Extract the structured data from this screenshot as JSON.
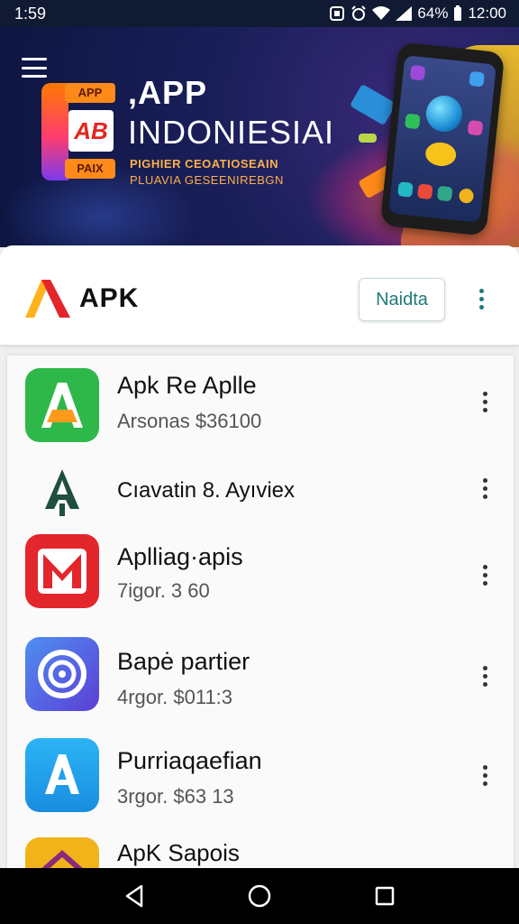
{
  "status_bar": {
    "time_left": "1:59",
    "battery": "64%",
    "time_right": "12:00"
  },
  "hero": {
    "badge_top": "APP",
    "badge_mid": "AB",
    "badge_bottom": "PAIX",
    "title_line1": ",APP",
    "title_line2": "INDONIESIAI",
    "subtitle_line1": "PIGHIER CEOATIOSEAIN",
    "subtitle_line2": "PLUAVIA GESEENIREBGN"
  },
  "header": {
    "brand": "APK",
    "action_button": "Naidta"
  },
  "apps": [
    {
      "title": "Apk Re Aplle",
      "subtitle": "Arsonas $36100",
      "icon": "android-a-icon",
      "color": "#2eb84a"
    },
    {
      "title": "Cıavatin 8. Ayıviex",
      "subtitle": "",
      "icon": "tree-a-icon",
      "color": "#1f4f3f"
    },
    {
      "title": "Aplliag·apis",
      "subtitle": "7igor. 3 60",
      "icon": "m-brand-icon",
      "color": "#e3262c"
    },
    {
      "title": "Bapė partier",
      "subtitle": "4rgor. $011:3",
      "icon": "spiral-icon",
      "color": "#3b6fe8"
    },
    {
      "title": "Purriaqaefian",
      "subtitle": "3rgor. $63 13",
      "icon": "app-store-a-icon",
      "color": "#1fa2f0"
    },
    {
      "title": "ApK Sapois",
      "subtitle": "",
      "icon": "house-icon",
      "color": "#f2b21a"
    }
  ]
}
